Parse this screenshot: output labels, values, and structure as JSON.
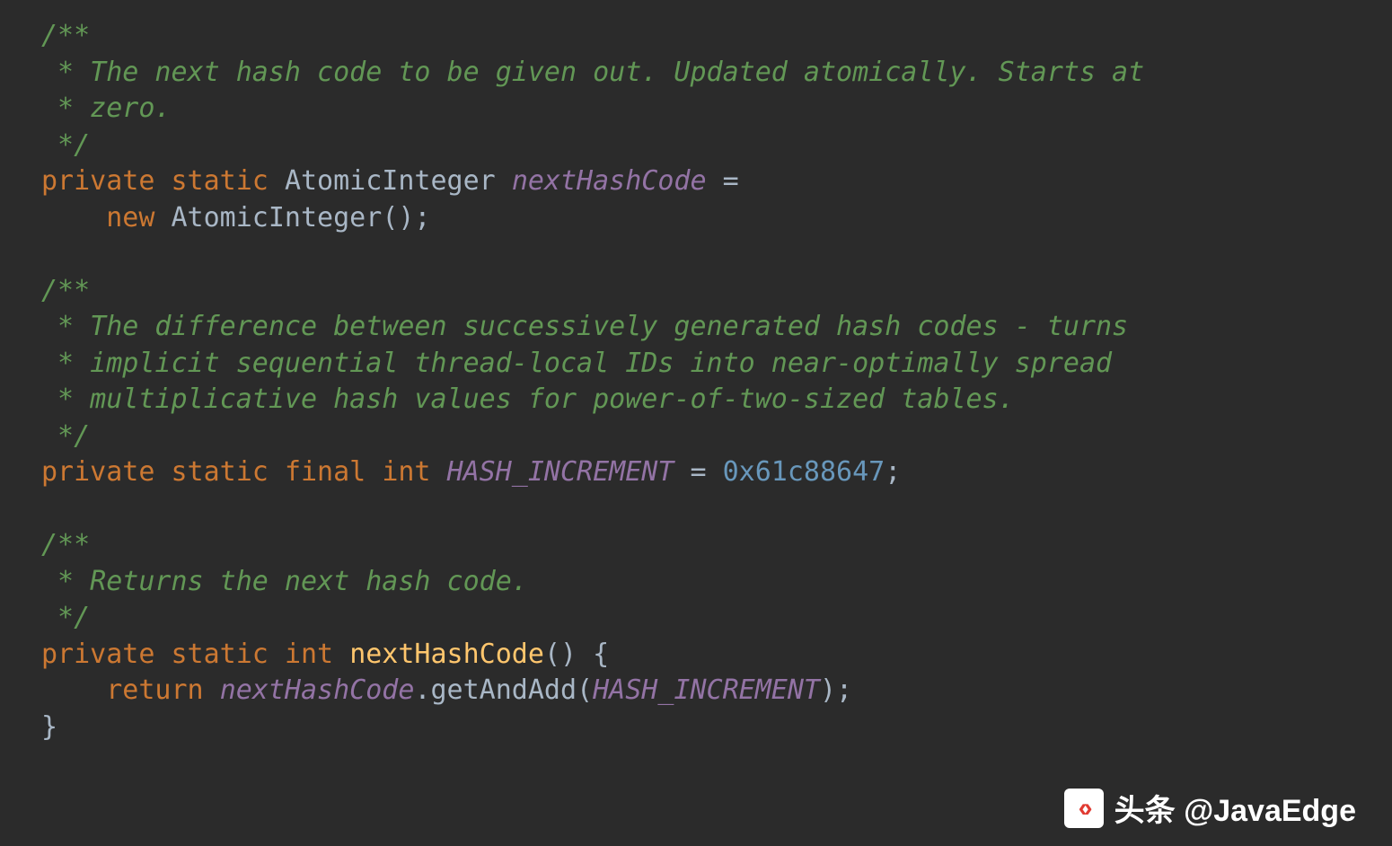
{
  "code": {
    "c1_l1": "/**",
    "c1_l2": " * The next hash code to be given out. Updated atomically. Starts at",
    "c1_l3": " * zero.",
    "c1_l4": " */",
    "kw_private": "private",
    "kw_static": "static",
    "kw_final": "final",
    "kw_int": "int",
    "kw_new": "new",
    "kw_return": "return",
    "ty_AtomicInteger": "AtomicInteger",
    "sf_nextHashCode": "nextHashCode",
    "op_eq": " =",
    "pn_unit_semi": "();",
    "c2_l1": "/**",
    "c2_l2": " * The difference between successively generated hash codes - turns",
    "c2_l3": " * implicit sequential thread-local IDs into near-optimally spread",
    "c2_l4": " * multiplicative hash values for power-of-two-sized tables.",
    "c2_l5": " */",
    "sf_HASH_INCREMENT": "HASH_INCREMENT",
    "num_hex": "0x61c88647",
    "pn_semi": ";",
    "c3_l1": "/**",
    "c3_l2": " * Returns the next hash code.",
    "c3_l3": " */",
    "fn_nextHashCode": "nextHashCode",
    "pn_paren_brace": "() {",
    "fn_getAndAdd": ".getAndAdd(",
    "pn_close_call": ");",
    "pn_cbrace": "}"
  },
  "watermark": {
    "text": "头条 @JavaEdge",
    "icon": "‹›"
  }
}
